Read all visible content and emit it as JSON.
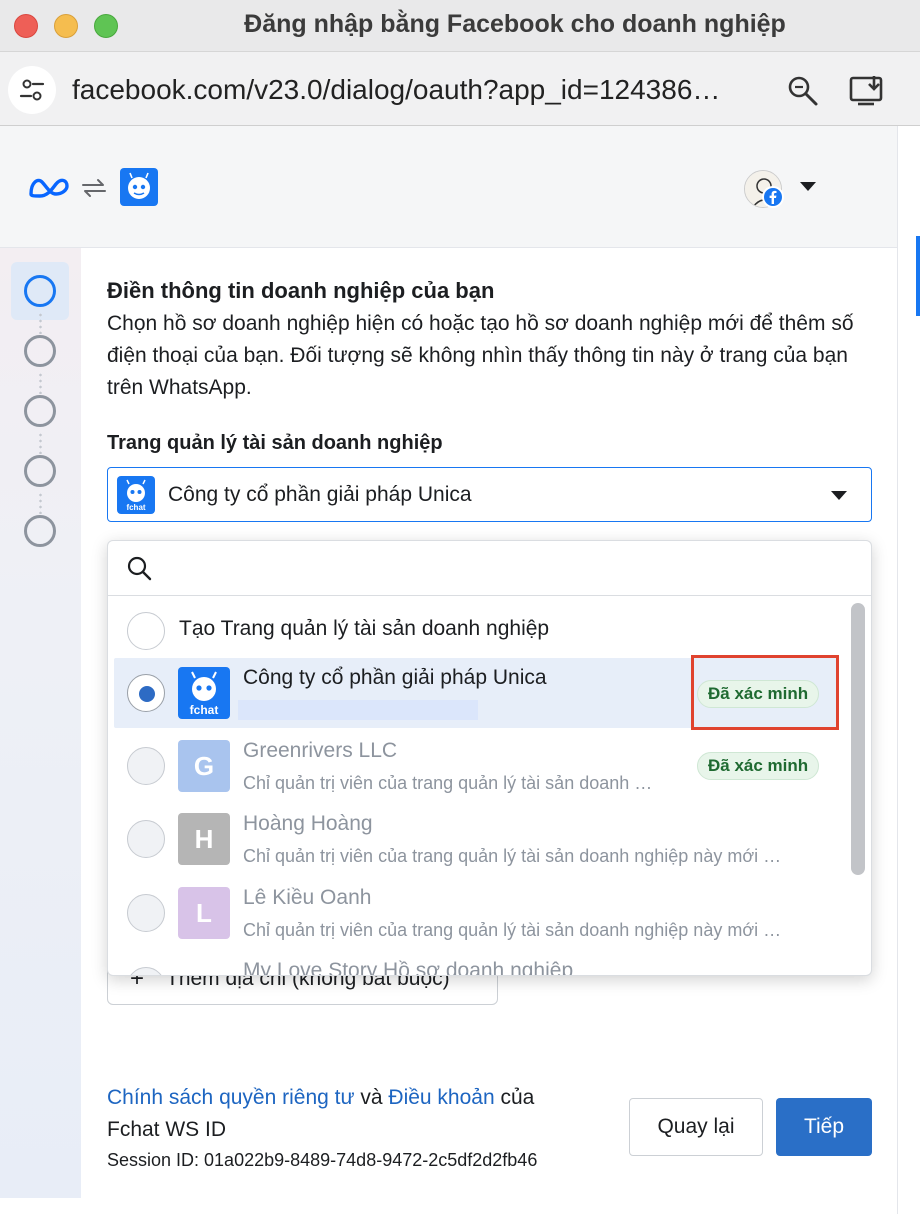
{
  "window": {
    "title": "Đăng nhập bằng Facebook cho doanh nghiệp"
  },
  "address_bar": {
    "url": "facebook.com/v23.0/dialog/oauth?app_id=124386…"
  },
  "form": {
    "title": "Điền thông tin doanh nghiệp của bạn",
    "description": "Chọn hồ sơ doanh nghiệp hiện có hoặc tạo hồ sơ doanh nghiệp mới để thêm số điện thoại của bạn. Đối tượng sẽ không nhìn thấy thông tin này ở trang của bạn trên WhatsApp.",
    "field_label": "Trang quản lý tài sản doanh nghiệp",
    "selected_value": "Công ty cổ phần giải pháp Unica",
    "add_address_label": "Thêm địa chỉ (không bắt buộc)"
  },
  "dropdown": {
    "search_placeholder": "",
    "items": [
      {
        "name": "Tạo Trang quản lý tài sản doanh nghiệp",
        "subtitle": "",
        "letter": "",
        "badge": "",
        "selected": false
      },
      {
        "name": "Công ty cổ phần giải pháp Unica",
        "subtitle": "",
        "letter": "",
        "badge": "Đã xác minh",
        "selected": true
      },
      {
        "name": "Greenrivers LLC",
        "subtitle": "Chỉ quản trị viên của trang quản lý tài sản doanh …",
        "letter": "G",
        "badge": "Đã xác minh",
        "selected": false
      },
      {
        "name": "Hoàng Hoàng",
        "subtitle": "Chỉ quản trị viên của trang quản lý tài sản doanh nghiệp này mới …",
        "letter": "H",
        "badge": "",
        "selected": false
      },
      {
        "name": "Lê Kiều Oanh",
        "subtitle": "Chỉ quản trị viên của trang quản lý tài sản doanh nghiệp này mới …",
        "letter": "L",
        "badge": "",
        "selected": false
      },
      {
        "name": "My Love Story Hồ sơ doanh nghiệp",
        "subtitle": "",
        "letter": "",
        "badge": "",
        "selected": false
      }
    ]
  },
  "footer": {
    "privacy_link": "Chính sách quyền riêng tư",
    "and_text": " và ",
    "terms_link": "Điều khoản",
    "of_text": " của",
    "app_name": "Fchat WS ID",
    "session": "Session ID: 01a022b9-8489-74d8-9472-2c5df2d2fb46",
    "back_label": "Quay lại",
    "next_label": "Tiếp"
  },
  "colors": {
    "accent": "#1877f2",
    "verified_bg": "#e8f5ea",
    "verified_text": "#1f6a31",
    "highlight": "#e0432f",
    "letter_g": "#a9c4ee",
    "letter_h": "#b5b5b5",
    "letter_l": "#d8c3e8"
  }
}
